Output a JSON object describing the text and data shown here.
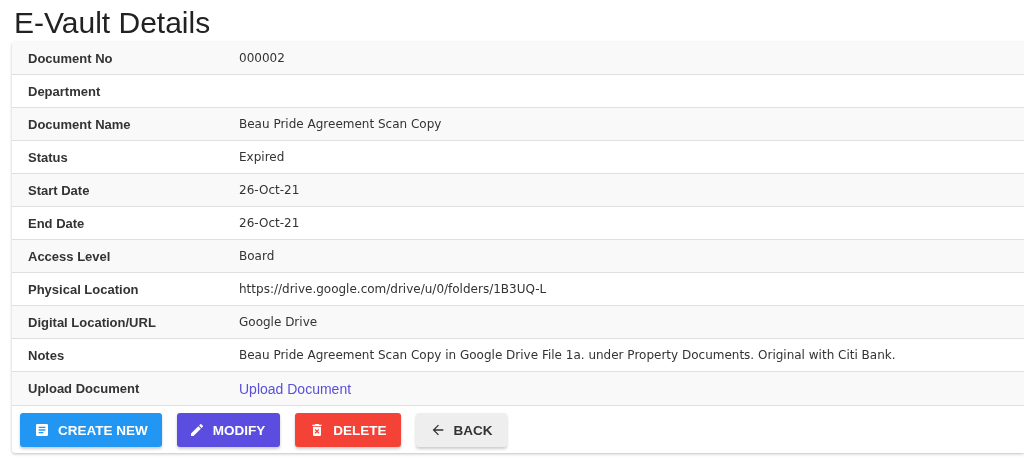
{
  "title": "E-Vault Details",
  "rows": [
    {
      "label": "Document No",
      "value": "000002",
      "kind": "text"
    },
    {
      "label": "Department"
    },
    {
      "label": "Document Name",
      "value": "Beau Pride Agreement Scan Copy",
      "kind": "text"
    },
    {
      "label": "Status",
      "value": "Expired",
      "kind": "text"
    },
    {
      "label": "Start Date",
      "value": "26-Oct-21",
      "kind": "text"
    },
    {
      "label": "End Date",
      "value": "26-Oct-21",
      "kind": "text"
    },
    {
      "label": "Access Level",
      "value": "Board",
      "kind": "text"
    },
    {
      "label": "Physical Location",
      "value": "https://drive.google.com/drive/u/0/folders/1B3UQ-L",
      "kind": "text"
    },
    {
      "label": "Digital Location/URL",
      "value": "Google Drive",
      "kind": "text"
    },
    {
      "label": "Notes",
      "value": "Beau Pride Agreement Scan Copy in Google Drive File 1a. under Property Documents. Original with Citi Bank.",
      "kind": "text"
    },
    {
      "label": "Upload Document",
      "value": "Upload Document",
      "kind": "link"
    }
  ],
  "buttons": [
    {
      "label": "CREATE NEW",
      "kind": "create"
    },
    {
      "label": "MODIFY",
      "kind": "modify"
    },
    {
      "label": "DELETE",
      "kind": "delete"
    },
    {
      "label": "BACK",
      "kind": "back"
    }
  ]
}
